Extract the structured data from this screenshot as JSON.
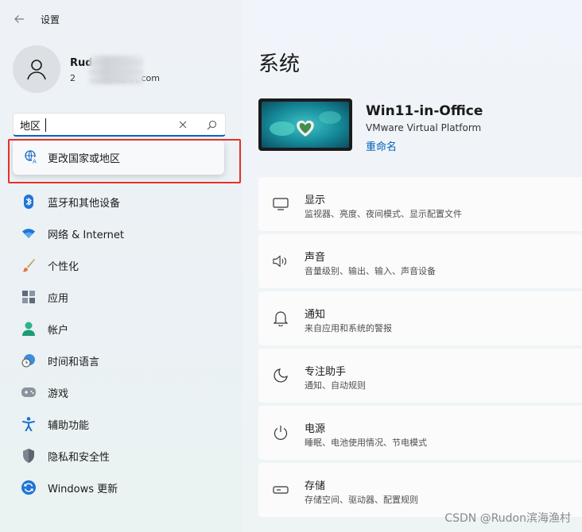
{
  "app": {
    "title": "设置"
  },
  "profile": {
    "name": "Rud",
    "email_prefix": "2",
    "email_suffix": "@qq.com"
  },
  "search": {
    "value": "地区",
    "suggestion": "更改国家或地区"
  },
  "nav": [
    {
      "label": "蓝牙和其他设备",
      "icon": "bluetooth-icon"
    },
    {
      "label": "网络 & Internet",
      "icon": "wifi-icon"
    },
    {
      "label": "个性化",
      "icon": "brush-icon"
    },
    {
      "label": "应用",
      "icon": "apps-icon"
    },
    {
      "label": "帐户",
      "icon": "account-icon"
    },
    {
      "label": "时间和语言",
      "icon": "time-language-icon"
    },
    {
      "label": "游戏",
      "icon": "gamepad-icon"
    },
    {
      "label": "辅助功能",
      "icon": "accessibility-icon"
    },
    {
      "label": "隐私和安全性",
      "icon": "shield-icon"
    },
    {
      "label": "Windows 更新",
      "icon": "update-icon"
    }
  ],
  "main": {
    "title": "系统",
    "device": {
      "name": "Win11-in-Office",
      "platform": "VMware Virtual Platform",
      "rename": "重命名"
    },
    "cards": [
      {
        "title": "显示",
        "subtitle": "监视器、亮度、夜间模式、显示配置文件",
        "icon": "display-icon"
      },
      {
        "title": "声音",
        "subtitle": "音量级别、输出、输入、声音设备",
        "icon": "speaker-icon"
      },
      {
        "title": "通知",
        "subtitle": "来自应用和系统的警报",
        "icon": "bell-icon"
      },
      {
        "title": "专注助手",
        "subtitle": "通知、自动规则",
        "icon": "moon-icon"
      },
      {
        "title": "电源",
        "subtitle": "睡眠、电池使用情况、节电模式",
        "icon": "power-icon"
      },
      {
        "title": "存储",
        "subtitle": "存储空间、驱动器、配置规则",
        "icon": "storage-icon"
      }
    ]
  },
  "watermark": "CSDN @Rudon滨海渔村",
  "colors": {
    "accent": "#0067c0",
    "highlight": "#e2322b",
    "link": "#005fb8"
  }
}
